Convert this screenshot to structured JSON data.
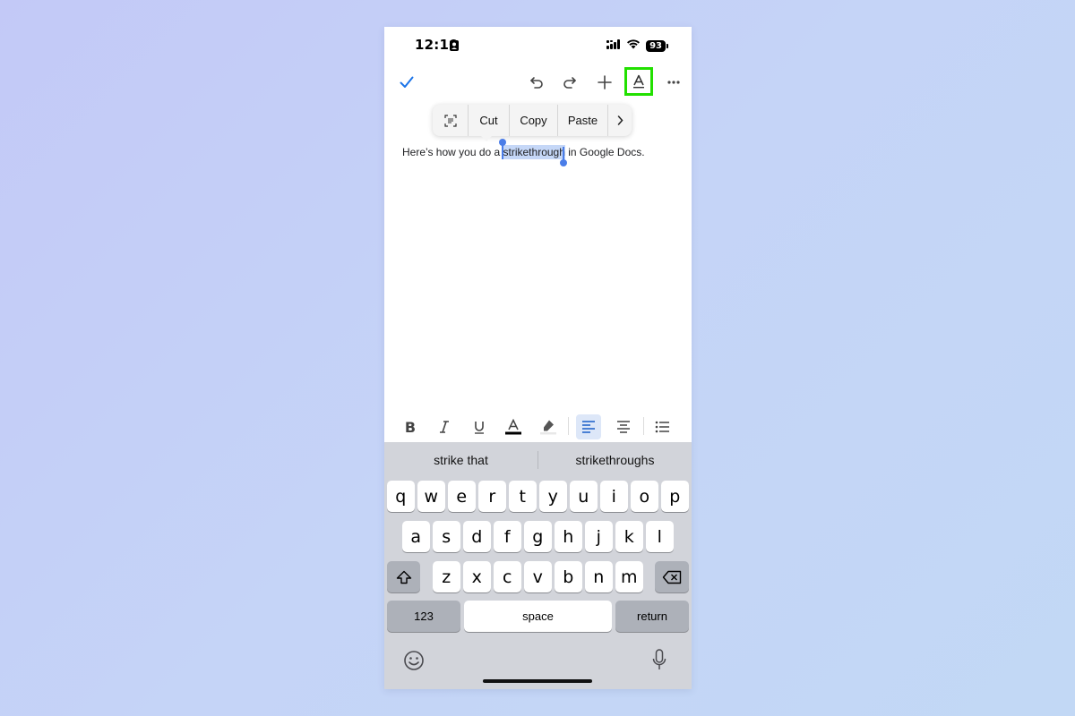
{
  "status": {
    "time": "12:10",
    "battery": "93"
  },
  "context_menu": {
    "cut": "Cut",
    "copy": "Copy",
    "paste": "Paste"
  },
  "document": {
    "before": "Here’s how you do a ",
    "selected": "strikethrough",
    "after": " in Google Docs."
  },
  "suggestions": [
    "strike that",
    "strikethroughs"
  ],
  "keyboard": {
    "row1": [
      "q",
      "w",
      "e",
      "r",
      "t",
      "y",
      "u",
      "i",
      "o",
      "p"
    ],
    "row2": [
      "a",
      "s",
      "d",
      "f",
      "g",
      "h",
      "j",
      "k",
      "l"
    ],
    "row3": [
      "z",
      "x",
      "c",
      "v",
      "b",
      "n",
      "m"
    ],
    "numbers_label": "123",
    "space_label": "space",
    "return_label": "return"
  },
  "colors": {
    "highlight_outline": "#22e000",
    "accent": "#1a73e8",
    "selection": "#c5d7f7"
  }
}
